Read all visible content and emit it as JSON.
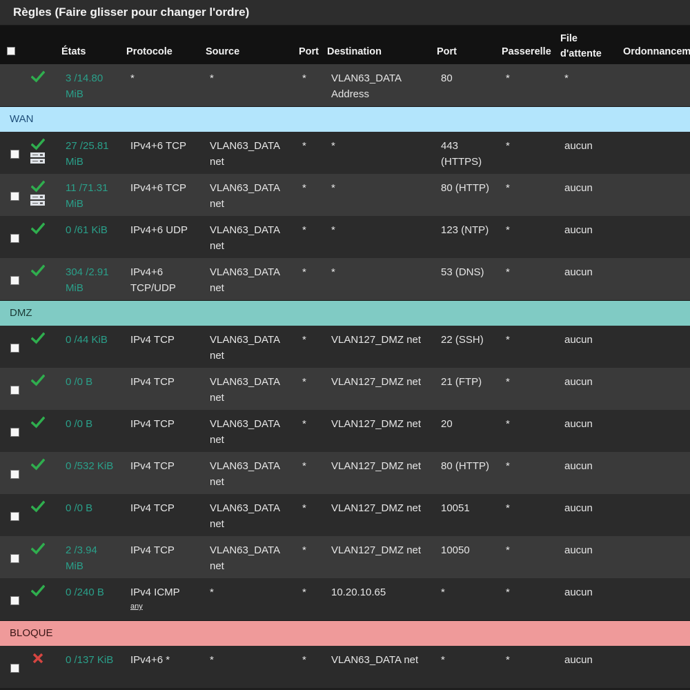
{
  "title": "Règles (Faire glisser pour changer l'ordre)",
  "columns": {
    "states": "États",
    "protocol": "Protocole",
    "source": "Source",
    "source_port": "Port",
    "destination": "Destination",
    "dest_port": "Port",
    "gateway": "Passerelle",
    "queue_line1": "File",
    "queue_line2": "d'attente",
    "schedule": "Ordonnancem"
  },
  "colors": {
    "accent_states": "#2aa08a",
    "check_green": "#2fae4e",
    "block_red": "#d64541",
    "wan_bg": "#b3e5fc",
    "dmz_bg": "#80cbc4",
    "bloque_bg": "#ef9a9a"
  },
  "top_rule": {
    "status_icon": "check-icon",
    "states_line1": "3 /14.80",
    "states_line2": "MiB",
    "protocol": "*",
    "source": "*",
    "source_port": "*",
    "destination_line1": "VLAN63_DATA",
    "destination_line2": "Address",
    "dest_port": "80",
    "gateway": "*",
    "queue": "*"
  },
  "separators": {
    "wan": "WAN",
    "dmz": "DMZ",
    "bloque": "BLOQUE"
  },
  "wan_rules": [
    {
      "states1": "27 /25.81",
      "states2": "MiB",
      "protocol1": "IPv4+6 TCP",
      "protocol2": "",
      "source1": "VLAN63_DATA",
      "source2": "net",
      "sport": "*",
      "dest": "*",
      "dport1": "443",
      "dport2": "(HTTPS)",
      "gateway": "*",
      "queue": "aucun",
      "icon": "check-icon",
      "extra_icon": "server-icon"
    },
    {
      "states1": "11 /71.31",
      "states2": "MiB",
      "protocol1": "IPv4+6 TCP",
      "protocol2": "",
      "source1": "VLAN63_DATA",
      "source2": "net",
      "sport": "*",
      "dest": "*",
      "dport1": "80 (HTTP)",
      "dport2": "",
      "gateway": "*",
      "queue": "aucun",
      "icon": "check-icon",
      "extra_icon": "server-icon"
    },
    {
      "states1": "0 /61 KiB",
      "states2": "",
      "protocol1": "IPv4+6 UDP",
      "protocol2": "",
      "source1": "VLAN63_DATA",
      "source2": "net",
      "sport": "*",
      "dest": "*",
      "dport1": "123 (NTP)",
      "dport2": "",
      "gateway": "*",
      "queue": "aucun",
      "icon": "check-icon",
      "extra_icon": ""
    },
    {
      "states1": "304 /2.91",
      "states2": "MiB",
      "protocol1": "IPv4+6",
      "protocol2": "TCP/UDP",
      "source1": "VLAN63_DATA",
      "source2": "net",
      "sport": "*",
      "dest": "*",
      "dport1": "53 (DNS)",
      "dport2": "",
      "gateway": "*",
      "queue": "aucun",
      "icon": "check-icon",
      "extra_icon": ""
    }
  ],
  "dmz_rules": [
    {
      "states1": "0 /44 KiB",
      "states2": "",
      "protocol1": "IPv4 TCP",
      "protocol2": "",
      "source1": "VLAN63_DATA",
      "source2": "net",
      "sport": "*",
      "dest": "VLAN127_DMZ net",
      "dport1": "22 (SSH)",
      "dport2": "",
      "gateway": "*",
      "queue": "aucun",
      "icon": "check-icon"
    },
    {
      "states1": "0 /0 B",
      "states2": "",
      "protocol1": "IPv4 TCP",
      "protocol2": "",
      "source1": "VLAN63_DATA",
      "source2": "net",
      "sport": "*",
      "dest": "VLAN127_DMZ net",
      "dport1": "21 (FTP)",
      "dport2": "",
      "gateway": "*",
      "queue": "aucun",
      "icon": "check-icon"
    },
    {
      "states1": "0 /0 B",
      "states2": "",
      "protocol1": "IPv4 TCP",
      "protocol2": "",
      "source1": "VLAN63_DATA",
      "source2": "net",
      "sport": "*",
      "dest": "VLAN127_DMZ net",
      "dport1": "20",
      "dport2": "",
      "gateway": "*",
      "queue": "aucun",
      "icon": "check-icon"
    },
    {
      "states1": "0 /532 KiB",
      "states2": "",
      "protocol1": "IPv4 TCP",
      "protocol2": "",
      "source1": "VLAN63_DATA",
      "source2": "net",
      "sport": "*",
      "dest": "VLAN127_DMZ net",
      "dport1": "80 (HTTP)",
      "dport2": "",
      "gateway": "*",
      "queue": "aucun",
      "icon": "check-icon"
    },
    {
      "states1": "0 /0 B",
      "states2": "",
      "protocol1": "IPv4 TCP",
      "protocol2": "",
      "source1": "VLAN63_DATA",
      "source2": "net",
      "sport": "*",
      "dest": "VLAN127_DMZ net",
      "dport1": "10051",
      "dport2": "",
      "gateway": "*",
      "queue": "aucun",
      "icon": "check-icon"
    },
    {
      "states1": "2 /3.94",
      "states2": "MiB",
      "protocol1": "IPv4 TCP",
      "protocol2": "",
      "source1": "VLAN63_DATA",
      "source2": "net",
      "sport": "*",
      "dest": "VLAN127_DMZ net",
      "dport1": "10050",
      "dport2": "",
      "gateway": "*",
      "queue": "aucun",
      "icon": "check-icon"
    },
    {
      "states1": "0 /240 B",
      "states2": "",
      "protocol1": "IPv4 ICMP",
      "protocol2": "any",
      "source1": "*",
      "source2": "",
      "sport": "*",
      "dest": "10.20.10.65",
      "dport1": "*",
      "dport2": "",
      "gateway": "*",
      "queue": "aucun",
      "icon": "check-icon"
    }
  ],
  "bloque_rules": [
    {
      "states1": "0 /137 KiB",
      "states2": "",
      "protocol1": "IPv4+6 *",
      "protocol2": "",
      "source1": "*",
      "source2": "",
      "sport": "*",
      "dest": "VLAN63_DATA net",
      "dport1": "*",
      "dport2": "",
      "gateway": "*",
      "queue": "aucun",
      "icon": "block-icon"
    }
  ]
}
